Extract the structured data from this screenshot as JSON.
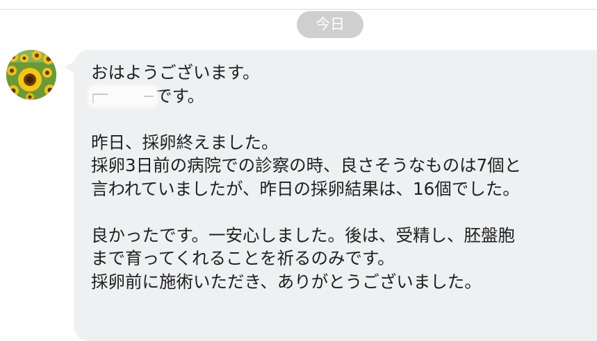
{
  "date_chip": {
    "label": "今日"
  },
  "avatar": {
    "icon": "sunflower-avatar-icon"
  },
  "message": {
    "line_1": "おはようございます。",
    "line_2_suffix": "です。",
    "line_3": "昨日、採卵終えました。",
    "line_4": "採卵3日前の病院での診察の時、良さそうなものは7個と",
    "line_5": "言われていましたが、昨日の採卵結果は、16個でした。",
    "line_6": "良かったです。一安心しました。後は、受精し、胚盤胞",
    "line_7": "まで育ってくれることを祈るのみです。",
    "line_8": "採卵前に施術いただき、ありがとうございました。"
  },
  "colors": {
    "bubble": "#eef0f1",
    "date_chip": "#cfcfcf",
    "text": "#1f1f1f"
  }
}
